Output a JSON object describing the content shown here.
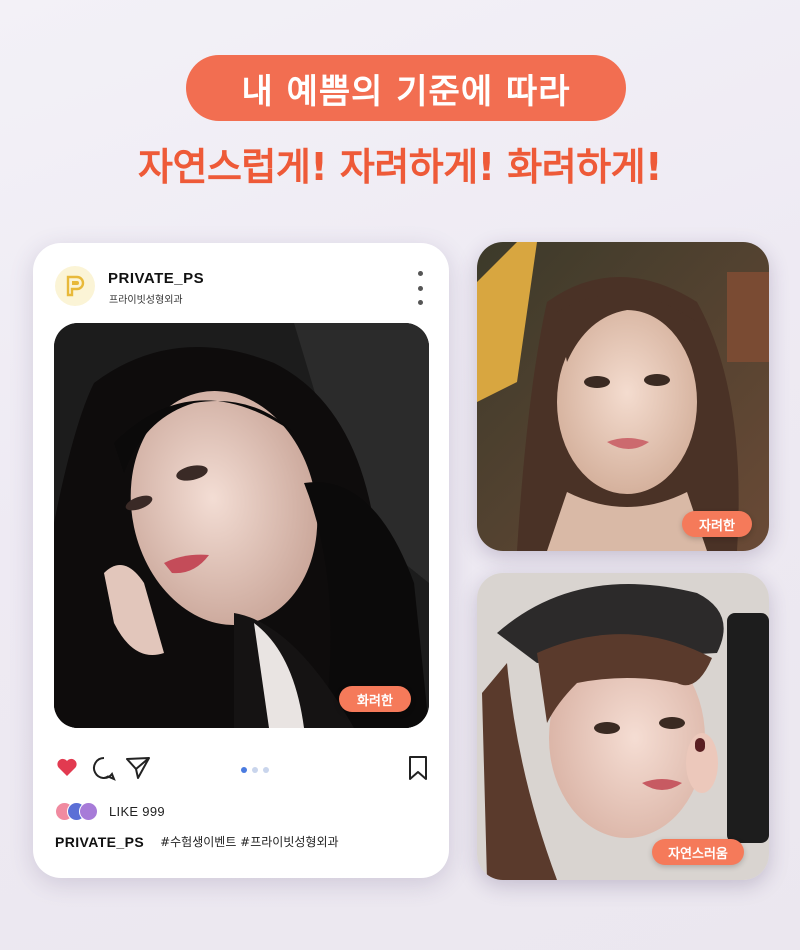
{
  "header": {
    "pill_text": "내 예쁨의 기준에 따라",
    "subhead": "자연스럽게! 자려하게! 화려하게!"
  },
  "post": {
    "account_name": "PRIVATE_PS",
    "account_sub": "프라이빗성형외과",
    "main_tag": "화려한",
    "like_text": "LIKE 999",
    "caption_name": "PRIVATE_PS",
    "caption_tags": "#수험생이벤트 #프라이빗성형외과",
    "carousel_dots": 3,
    "active_dot": 0
  },
  "side_photos": {
    "top_tag": "자려한",
    "bottom_tag": "자연스러움"
  },
  "colors": {
    "accent": "#f26e51",
    "heart": "#e23a50",
    "dot_active": "#4a7be0"
  },
  "icons": [
    "heart-icon",
    "comment-icon",
    "send-icon",
    "bookmark-icon",
    "more-vertical-icon",
    "logo-p-icon"
  ]
}
